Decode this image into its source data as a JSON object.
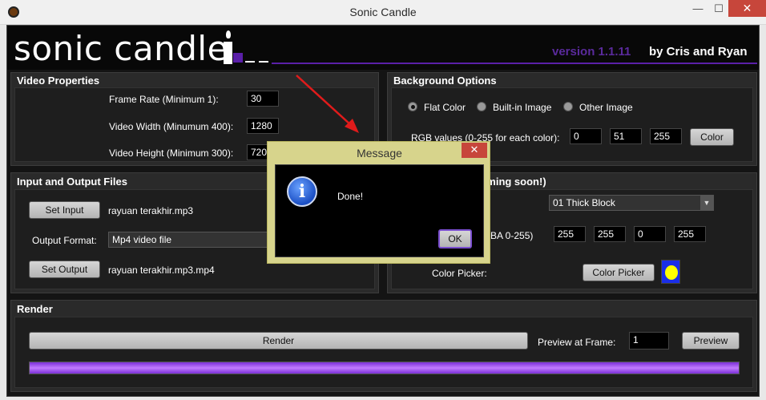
{
  "window": {
    "title": "Sonic Candle",
    "minimize": "—",
    "maximize": "☐",
    "close": "✕"
  },
  "header": {
    "logo": "sonic candle",
    "version": "version 1.1.11",
    "authors": "by Cris and Ryan"
  },
  "video_properties": {
    "title": "Video Properties",
    "frame_rate_label": "Frame Rate (Minimum 1):",
    "frame_rate": "30",
    "width_label": "Video Width (Minumum 400):",
    "width": "1280",
    "height_label": "Video Height (Minimum 300):",
    "height": "720"
  },
  "background": {
    "title": "Background Options",
    "radios": [
      "Flat Color",
      "Built-in Image",
      "Other Image"
    ],
    "selected": "Flat Color",
    "rgb_label": "RGB values (0-255 for each color):",
    "rgb": [
      "0",
      "51",
      "255"
    ],
    "color_button": "Color"
  },
  "io": {
    "title": "Input and Output Files",
    "set_input": "Set Input",
    "input_file": "rayuan terakhir.mp3",
    "output_format_label": "Output Format:",
    "output_format": "Mp4 video file",
    "set_output": "Set Output",
    "output_file": "rayuan terakhir.mp3.mp4"
  },
  "visualization": {
    "title_partial": "n (More options coming soon!)",
    "style": "01 Thick Block",
    "rgba_label_partial": "BA 0-255)",
    "rgba": [
      "255",
      "255",
      "0",
      "255"
    ],
    "color_picker_label": "Color Picker:",
    "color_picker_button": "Color Picker",
    "swatch_color": "#ffff00"
  },
  "render": {
    "title": "Render",
    "render_button": "Render",
    "preview_label": "Preview at Frame:",
    "preview_frame": "1",
    "preview_button": "Preview",
    "progress": 1.0
  },
  "dialog": {
    "title": "Message",
    "close": "✕",
    "icon": "i",
    "message": "Done!",
    "ok": "OK"
  },
  "colors": {
    "accent": "#5a1fa8",
    "progress": "#a64dff",
    "dialog_frame": "#d7d48c",
    "arrow": "#e01b1b"
  }
}
